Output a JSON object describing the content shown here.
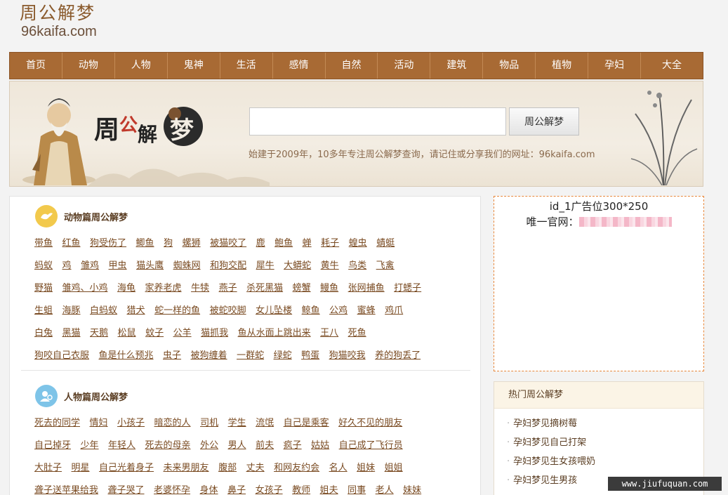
{
  "logo": {
    "cn": "周公解梦",
    "en": "96kaifa.com"
  },
  "nav": [
    "首页",
    "动物",
    "人物",
    "鬼神",
    "生活",
    "感情",
    "自然",
    "活动",
    "建筑",
    "物品",
    "植物",
    "孕妇",
    "大全"
  ],
  "banner": {
    "brand": [
      "周",
      "公",
      "解",
      "梦"
    ],
    "search_value": "",
    "search_button": "周公解梦",
    "slogan": "始建于2009年，10多年专注周公解梦查询，请记住或分享我们的网址：96kaifa.com"
  },
  "animal_section": {
    "title": "动物篇周公解梦",
    "rows": [
      [
        "带鱼",
        "红鱼",
        "狗受伤了",
        "鲫鱼",
        "狗",
        "螺狮",
        "被猫咬了",
        "鹿",
        "鲍鱼",
        "蝉",
        "耗子",
        "蝗虫",
        "蜻蜓"
      ],
      [
        "蚂蚁",
        "鸡",
        "雏鸡",
        "甲虫",
        "猫头鹰",
        "蜘蛛网",
        "和狗交配",
        "犀牛",
        "大蟒蛇",
        "黄牛",
        "鸟类",
        "飞禽"
      ],
      [
        "野猫",
        "雏鸡、小鸡",
        "海龟",
        "家养老虎",
        "牛犊",
        "燕子",
        "杀死黑猫",
        "螃蟹",
        "鳗鱼",
        "张网捕鱼",
        "打蟋子"
      ],
      [
        "生蛆",
        "海豚",
        "白蚂蚁",
        "猎犬",
        "蛇一样的鱼",
        "被蛇咬脚",
        "女儿坠楼",
        "鲸鱼",
        "公鸡",
        "蜜蜂",
        "鸡爪"
      ],
      [
        "白兔",
        "黑猫",
        "天鹅",
        "松鼠",
        "蚊子",
        "公羊",
        "猫抓我",
        "鱼从水面上跳出来",
        "王八",
        "死鱼"
      ],
      [
        "狗咬自己衣服",
        "鱼是什么预兆",
        "虫子",
        "被狗缠着",
        "一群蛇",
        "绿蛇",
        "鸭蛋",
        "狗猫咬我",
        "养的狗丢了"
      ]
    ]
  },
  "people_section": {
    "title": "人物篇周公解梦",
    "rows": [
      [
        "死去的同学",
        "情妇",
        "小孩子",
        "暗恋的人",
        "司机",
        "学生",
        "流氓",
        "自己是乘客",
        "好久不见的朋友"
      ],
      [
        "自己掉牙",
        "少年",
        "年轻人",
        "死去的母亲",
        "外公",
        "男人",
        "前夫",
        "疯子",
        "姑姑",
        "自己成了飞行员"
      ],
      [
        "大肚子",
        "明星",
        "自己光着身子",
        "未来男朋友",
        "腹部",
        "丈夫",
        "和网友约会",
        "名人",
        "姐妹",
        "姐姐"
      ],
      [
        "聋子送苹果给我",
        "聋子哭了",
        "老婆怀孕",
        "身体",
        "鼻子",
        "女孩子",
        "教师",
        "姐夫",
        "同事",
        "老人",
        "妹妹"
      ]
    ]
  },
  "ad": {
    "title": "id_1广告位300*250",
    "line_label": "唯一官网："
  },
  "hot": {
    "title": "热门周公解梦",
    "items": [
      "孕妇梦见摘树莓",
      "孕妇梦见自己打架",
      "孕妇梦见生女孩喂奶",
      "孕妇梦见生男孩"
    ]
  },
  "watermark": "www.jiufuquan.com",
  "colors": {
    "nav_bg": "#a86a34",
    "link": "#7a4b22",
    "ad_border": "#e8873a",
    "animal_icon": "#f2c94c",
    "people_icon": "#7ec4e8"
  }
}
